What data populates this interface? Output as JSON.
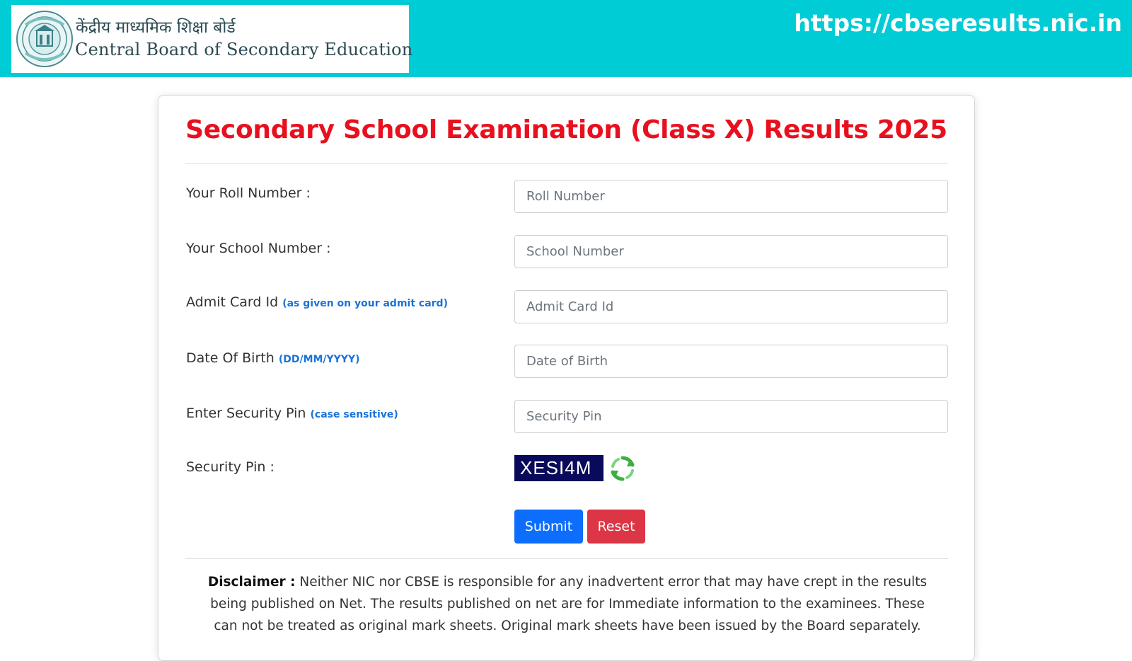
{
  "header": {
    "board_name_hindi": "केंद्रीय माध्यमिक शिक्षा बोर्ड",
    "board_name_english": "Central Board of Secondary Education",
    "site_url": "https://cbseresults.nic.in",
    "emblem_icon": "cbse-emblem-icon",
    "bar_color": "#00ccd6"
  },
  "form": {
    "title": "Secondary School Examination (Class X) Results 2025",
    "title_color": "#e8101e",
    "roll": {
      "label": "Your Roll Number :",
      "placeholder": "Roll Number",
      "value": ""
    },
    "school": {
      "label": "Your School Number :",
      "placeholder": "School Number",
      "value": ""
    },
    "admit": {
      "label": "Admit Card Id",
      "hint": "(as given on your admit card)",
      "placeholder": "Admit Card Id",
      "value": ""
    },
    "dob": {
      "label": "Date Of Birth",
      "hint": "(DD/MM/YYYY)",
      "placeholder": "Date of Birth",
      "value": ""
    },
    "pin": {
      "label": "Enter Security Pin",
      "hint": "(case sensitive)",
      "placeholder": "Security Pin",
      "value": ""
    },
    "captcha": {
      "label": "Security Pin :",
      "code": "XESI4M",
      "refresh_icon": "refresh-icon"
    },
    "submit_label": "Submit",
    "reset_label": "Reset",
    "submit_color": "#0d6efd",
    "reset_color": "#dc3545"
  },
  "disclaimer": {
    "heading": "Disclaimer :",
    "text": " Neither NIC nor CBSE is responsible for any inadvertent error that may have crept in the results being published on Net. The results published on net are for Immediate information to the examinees. These can not be treated as original mark sheets. Original mark sheets have been issued by the Board separately."
  }
}
